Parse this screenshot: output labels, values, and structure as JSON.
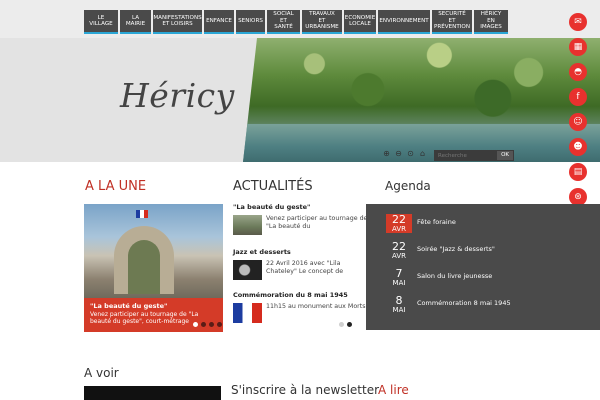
{
  "nav": {
    "items": [
      {
        "label": "LE VILLAGE",
        "color": "#2aa6d5"
      },
      {
        "label": "LA MAIRIE",
        "color": "#2aa6d5"
      },
      {
        "label": "MANIFESTATIONS ET LOISIRS",
        "color": "#2aa6d5"
      },
      {
        "label": "ENFANCE",
        "color": "#2aa6d5"
      },
      {
        "label": "SENIORS",
        "color": "#2aa6d5"
      },
      {
        "label": "SOCIAL ET SANTÉ",
        "color": "#2aa6d5"
      },
      {
        "label": "TRAVAUX ET URBANISME",
        "color": "#2aa6d5"
      },
      {
        "label": "ECONOMIE LOCALE",
        "color": "#2aa6d5"
      },
      {
        "label": "ENVIRONNEMENT",
        "color": "#2aa6d5"
      },
      {
        "label": "SECURITÉ ET PRÉVENTION",
        "color": "#2aa6d5"
      },
      {
        "label": "HÉRICY EN IMAGES",
        "color": "#2aa6d5"
      }
    ]
  },
  "header": {
    "logo_text": "Héricy",
    "search_placeholder": "Recherche",
    "search_button": "OK"
  },
  "tools": [
    "zoom-in-icon",
    "zoom-out-icon",
    "zoom-reset-icon",
    "home-icon"
  ],
  "social": [
    {
      "name": "mail-icon",
      "glyph": "✉"
    },
    {
      "name": "map-icon",
      "glyph": "▦"
    },
    {
      "name": "car-icon",
      "glyph": "◓"
    },
    {
      "name": "facebook-icon",
      "glyph": "f"
    },
    {
      "name": "user-icon",
      "glyph": "☺"
    },
    {
      "name": "profile-icon",
      "glyph": "☻"
    },
    {
      "name": "book-icon",
      "glyph": "▤"
    },
    {
      "name": "compass-icon",
      "glyph": "⊛"
    },
    {
      "name": "people-icon",
      "glyph": "♟"
    }
  ],
  "une": {
    "title": "A LA UNE",
    "caption_title": "\"La beauté du geste\"",
    "caption_text": "Venez participer au tournage de \"La beauté du geste\", court-métrage"
  },
  "actualites": {
    "title": "ACTUALITÉS",
    "items": [
      {
        "heading": "\"La beauté du geste\"",
        "text": "Venez participer au tournage de \"La beauté du"
      },
      {
        "heading": "Jazz et desserts",
        "text": "22 Avril 2016 avec \"Lila Chateley\" Le concept de"
      },
      {
        "heading": "Commémoration du 8 mai 1945",
        "text": "11h15 au monument aux Morts"
      }
    ]
  },
  "agenda": {
    "title": "Agenda",
    "items": [
      {
        "day": "22",
        "month": "AVR",
        "label": "Fête foraine",
        "active": true
      },
      {
        "day": "22",
        "month": "AVR",
        "label": "Soirée \"Jazz & desserts\"",
        "active": false
      },
      {
        "day": "7",
        "month": "MAI",
        "label": "Salon du livre jeunesse",
        "active": false
      },
      {
        "day": "8",
        "month": "MAI",
        "label": "Commémoration 8 mai 1945",
        "active": false
      }
    ]
  },
  "bottom": {
    "avoir_title": "A voir",
    "newsletter_title": "S'inscrire à la newsletter",
    "alire_title": "A lire"
  },
  "colors": {
    "accent": "#d43b28",
    "dark": "#4a4a4a",
    "nav_underline": "#2aa6d5"
  }
}
